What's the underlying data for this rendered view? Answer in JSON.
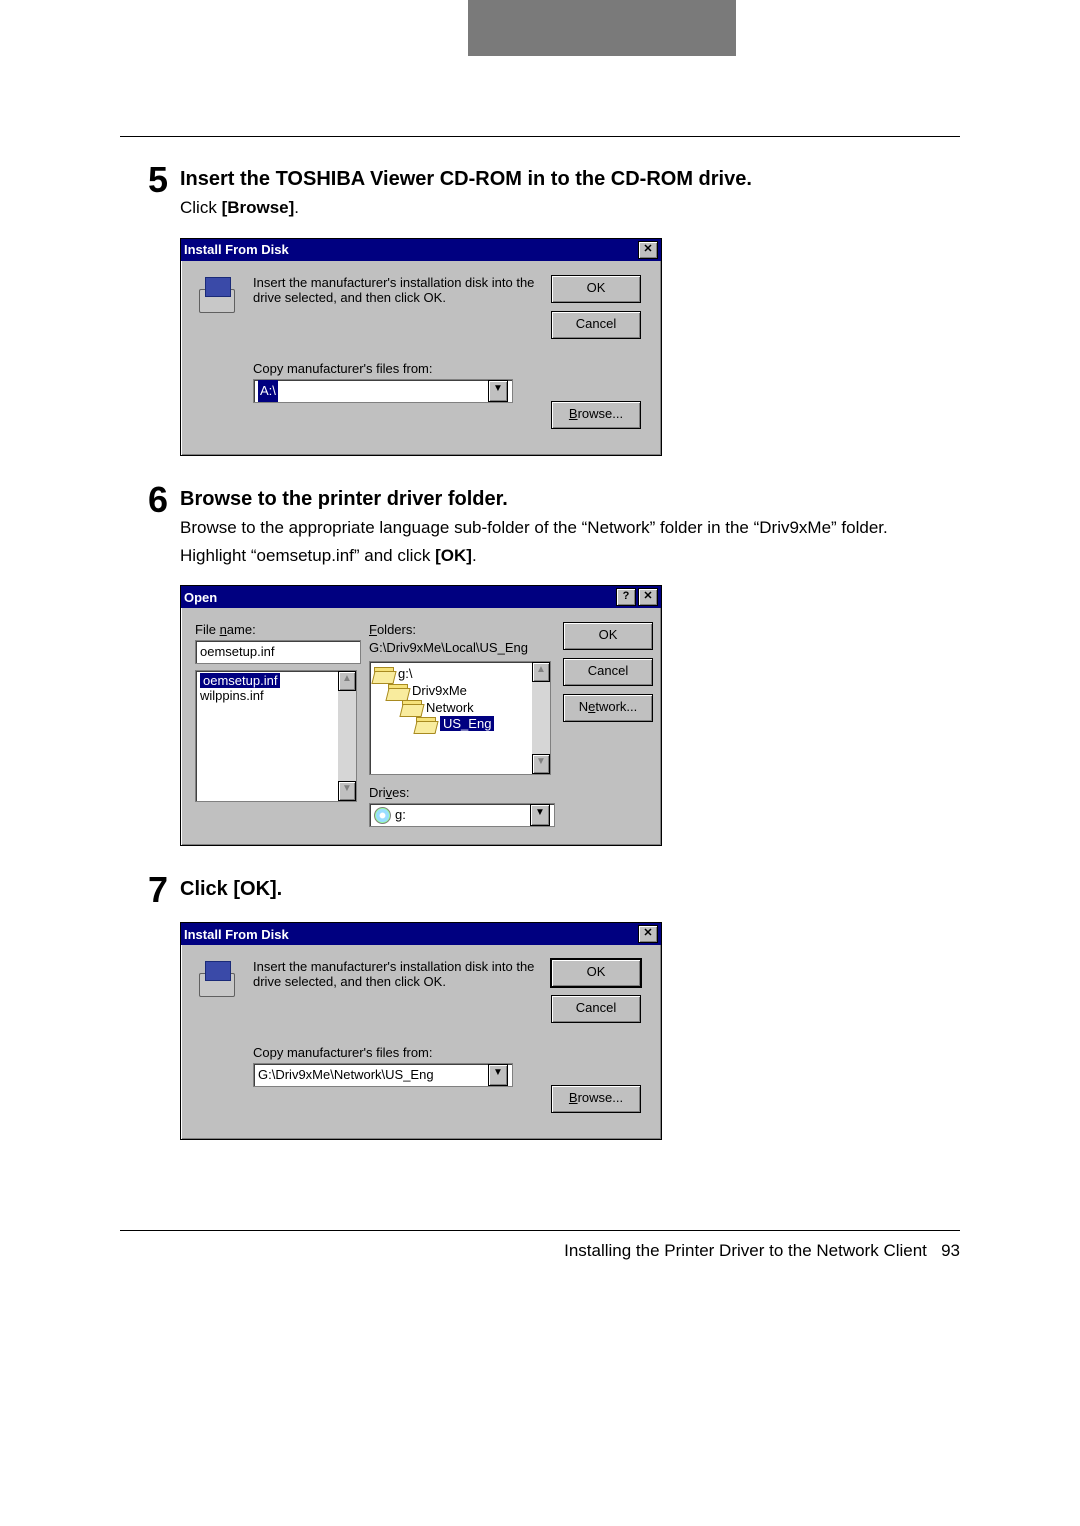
{
  "steps": {
    "s5": {
      "num": "5",
      "title": "Insert the TOSHIBA Viewer CD-ROM in to the CD-ROM drive.",
      "line1_pre": "Click ",
      "line1_bold": "[Browse]",
      "line1_post": "."
    },
    "s6": {
      "num": "6",
      "title": "Browse to the printer driver folder.",
      "line1": "Browse to the appropriate language sub-folder of the “Network” folder in the “Driv9xMe” folder.",
      "line2_pre": "Highlight “oemsetup.inf” and click ",
      "line2_bold": "[OK]",
      "line2_post": "."
    },
    "s7": {
      "num": "7",
      "title": "Click [OK]."
    }
  },
  "dlg_install": {
    "title": "Install From Disk",
    "msg": "Insert the manufacturer's installation disk into the drive selected, and then click OK.",
    "copy_label": "Copy manufacturer's files from:",
    "path1": "A:\\",
    "path2": "G:\\Driv9xMe\\Network\\US_Eng",
    "ok": "OK",
    "cancel": "Cancel",
    "browse": "Browse...",
    "browse_u": "B"
  },
  "dlg_open": {
    "title": "Open",
    "filename_label": "File name:",
    "filename_u": "n",
    "filename_value": "oemsetup.inf",
    "files": [
      "oemsetup.inf",
      "wilppins.inf"
    ],
    "folders_label": "Folders:",
    "folders_u": "F",
    "folders_path": "G:\\Driv9xMe\\Local\\US_Eng",
    "tree": [
      "g:\\",
      "Driv9xMe",
      "Network",
      "US_Eng"
    ],
    "drives_label": "Drives:",
    "drives_u": "v",
    "drive_value": "g:",
    "ok": "OK",
    "cancel": "Cancel",
    "network": "Network...",
    "network_u": "e"
  },
  "footer": {
    "text": "Installing the Printer Driver to the Network Client",
    "page": "93"
  }
}
